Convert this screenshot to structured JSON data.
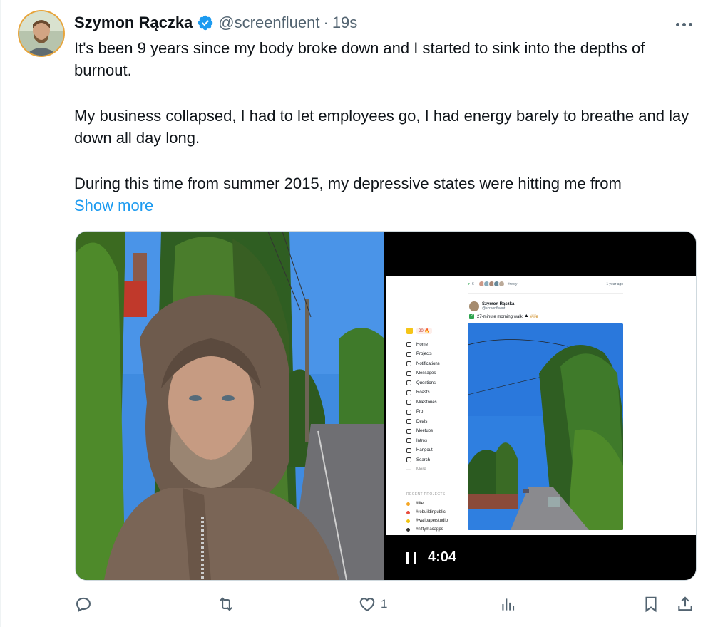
{
  "author": {
    "name": "Szymon Rączka",
    "handle": "@screenfluent",
    "separator": "·",
    "time": "19s"
  },
  "tweet": {
    "paragraphs": [
      "It's been 9 years since my body broke down and I started to sink into the depths of burnout.",
      "My business collapsed, I had to let employees go, I had energy barely to breathe and lay down all day long.",
      "During this time from summer 2015, my depressive states were hitting me from"
    ],
    "show_more": "Show more"
  },
  "video": {
    "duration": "4:04",
    "app": {
      "streak": "20 🔥",
      "nav_items": [
        "Home",
        "Projects",
        "Notifications",
        "Messages",
        "Questions",
        "Roasts",
        "Milestones",
        "Pro",
        "Deals",
        "Meetups",
        "Intros",
        "Hangout",
        "Search"
      ],
      "more": "More",
      "recent_projects_heading": "RECENT PROJECTS",
      "recent_projects": [
        "#life",
        "#rebuildinpublic",
        "#wallpaperstudio",
        "#niftymacapps"
      ],
      "likes_count": "6",
      "reply": "#reply",
      "post_age": "1 year ago",
      "post_author": "Szymon Rączka",
      "post_handle": "@screenfluent",
      "post_text": "27-minute morning walk",
      "post_tag": "#life"
    }
  },
  "actions": {
    "replies": "",
    "reposts": "",
    "likes": "1",
    "views": ""
  },
  "colors": {
    "accent": "#1d9bf0",
    "text": "#0f1419",
    "secondary": "#536471",
    "avatar_ring": "#e8a43a"
  }
}
